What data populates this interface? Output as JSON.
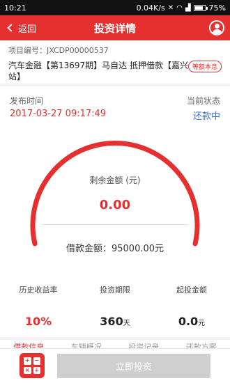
{
  "status_bar": {
    "time": "10:21",
    "speed": "0.04K/s",
    "battery": "75%",
    "battery_level": 0.75
  },
  "nav": {
    "back_label": "返回",
    "title": "投资详情",
    "user_icon": "user-icon"
  },
  "project": {
    "code": "项目编号：JXCDP00000537",
    "name": "汽车金融【第13697期】马自达 抵押借款【嘉兴站】",
    "badge": "等额本息"
  },
  "publish": {
    "label": "发布时间",
    "value": "2017-03-27 09:17:49"
  },
  "state": {
    "label": "当前状态",
    "value": "还款中"
  },
  "gauge": {
    "remaining_label": "剩余金额 (元)",
    "remaining_value": "0.00",
    "progress": 0.0
  },
  "loan": {
    "text": "借款金额：95000.00元"
  },
  "stats": [
    {
      "label": "历史收益率",
      "value": "10%",
      "unit": ""
    },
    {
      "label": "投资期限",
      "value": "360",
      "unit": "天"
    },
    {
      "label": "起投金额",
      "value": "0.0",
      "unit": "元"
    }
  ],
  "tabs": [
    "借款信息",
    "车辆概况",
    "投资记录",
    "还款方案"
  ],
  "footer": {
    "calculator_icon": "calculator-icon",
    "invest_label": "立即投资"
  },
  "colors": {
    "accent": "#e63030",
    "status_blue": "#3a76d8",
    "disabled": "#cfcfcf"
  }
}
